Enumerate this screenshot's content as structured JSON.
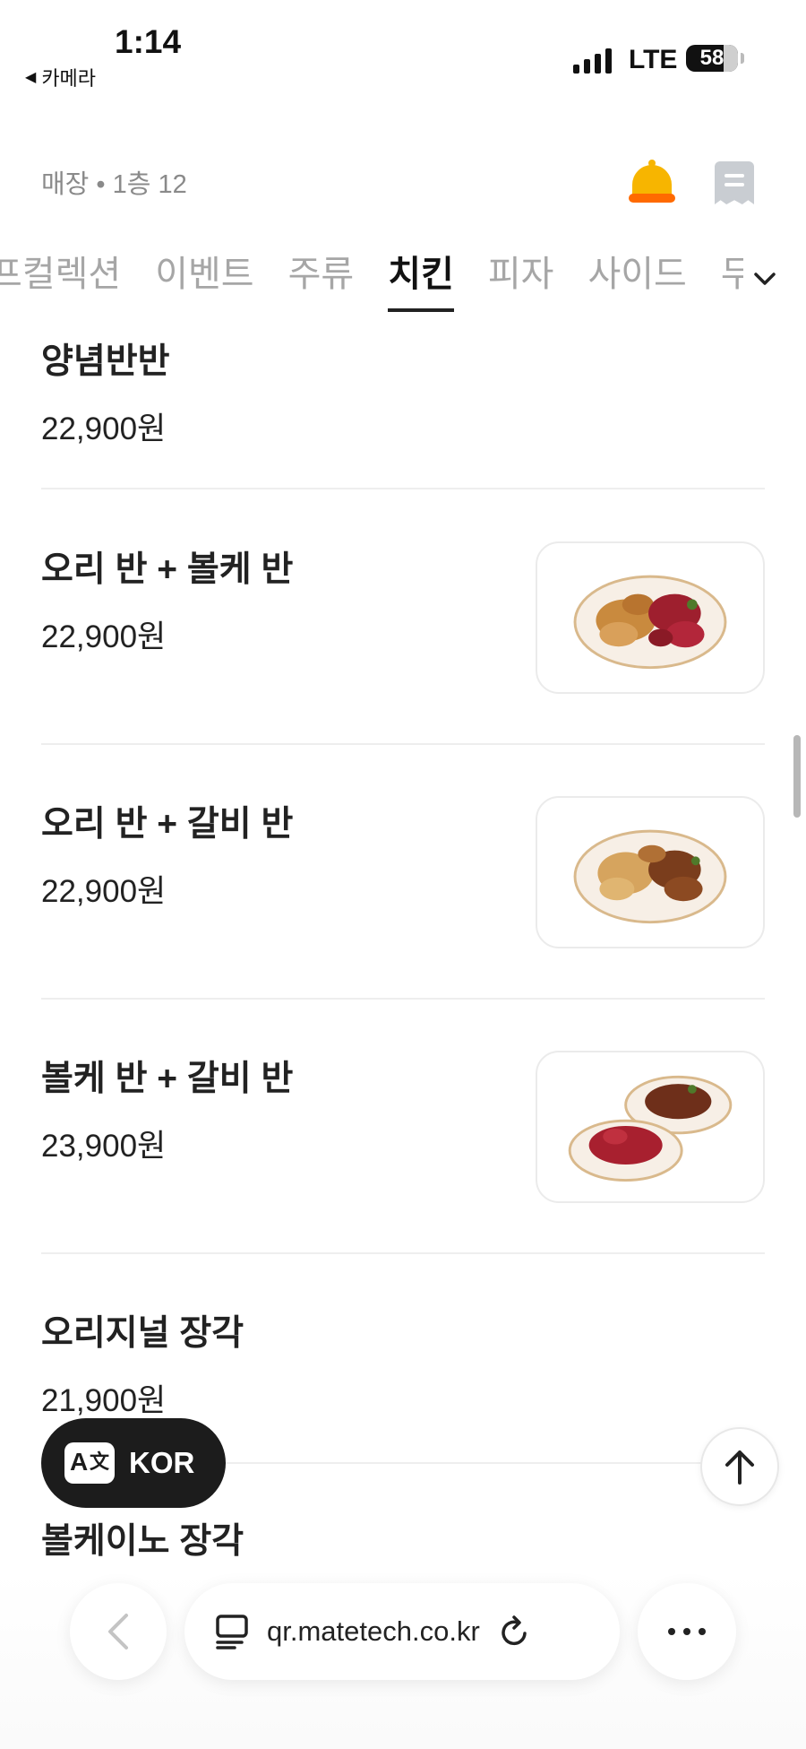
{
  "status_bar": {
    "time": "1:14",
    "back_app": "카메라",
    "network": "LTE",
    "battery": "58"
  },
  "header": {
    "store_info": "매장 • 1층 12",
    "icons": [
      "bell-icon",
      "receipt-icon"
    ]
  },
  "tabs": {
    "items": [
      {
        "label": "프컬렉션"
      },
      {
        "label": "이벤트"
      },
      {
        "label": "주류"
      },
      {
        "label": "치킨"
      },
      {
        "label": "피자"
      },
      {
        "label": "사이드"
      },
      {
        "label": "무"
      }
    ],
    "active": "치킨"
  },
  "menu": {
    "items": [
      {
        "name": "양념반반",
        "price": "22,900원",
        "image": false
      },
      {
        "name": "오리 반 + 볼케 반",
        "price": "22,900원",
        "image": true
      },
      {
        "name": "오리 반 + 갈비 반",
        "price": "22,900원",
        "image": true
      },
      {
        "name": "볼케 반 + 갈비 반",
        "price": "23,900원",
        "image": true
      },
      {
        "name": "오리지널 장각",
        "price": "21,900원",
        "image": false
      },
      {
        "name": "볼케이노 장각",
        "price": "",
        "image": false
      }
    ]
  },
  "language_button": {
    "icon_text": "A",
    "icon_sub": "文",
    "label": "KOR"
  },
  "browser": {
    "url": "qr.matetech.co.kr",
    "icons": [
      "back-icon",
      "tabs-icon",
      "reload-icon",
      "more-icon"
    ]
  },
  "colors": {
    "bell": "#f7b500",
    "bell_base": "#ff6a00",
    "text_primary": "#222222",
    "text_muted": "#a6a6a6"
  }
}
